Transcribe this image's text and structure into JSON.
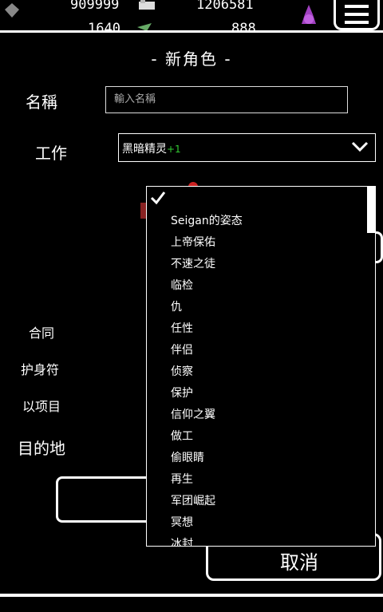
{
  "topbar": {
    "res1": "909999",
    "res2": "1206581",
    "res3": "1640",
    "res4": "888"
  },
  "title": "- 新角色 -",
  "form": {
    "name_label": "名稱",
    "name_placeholder": "輸入名稱",
    "job_label": "工作",
    "job_value": "黑暗精灵",
    "job_bonus": "+1",
    "contract_label": "合同",
    "amulet_label": "护身符",
    "item_label": "以项目",
    "destination_label": "目的地"
  },
  "cancel_label": "取消",
  "dropdown": {
    "options": [
      "Seigan的姿态",
      "上帝保佑",
      "不速之徒",
      "临检",
      "仇",
      "任性",
      "伴侣",
      "侦察",
      "保护",
      "信仰之翼",
      "做工",
      "偷眼睛",
      "再生",
      "军团崛起",
      "冥想",
      "冰封"
    ]
  },
  "colors": {
    "background": "#000000",
    "foreground": "#ffffff",
    "bonus": "#33cc33"
  }
}
